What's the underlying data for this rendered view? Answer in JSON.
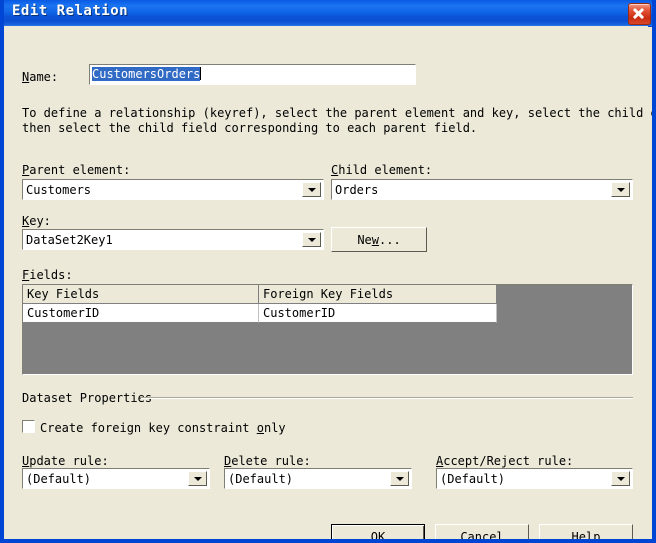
{
  "window": {
    "title": "Edit Relation",
    "close_icon": "close-icon",
    "accent_color": "#0046d5",
    "face_color": "#ece9d8",
    "selection_color": "#316ac5"
  },
  "name_field": {
    "label": "Name:",
    "label_accel": "N",
    "value": "CustomersOrders",
    "selected": true
  },
  "description": {
    "line1": "To define a relationship (keyref), select the parent element and key, select the child element, and",
    "line2": "then select the child field corresponding to each parent field."
  },
  "parent_element": {
    "label": "Parent element:",
    "label_accel": "P",
    "value": "Customers"
  },
  "child_element": {
    "label": "Child element:",
    "label_accel": "C",
    "value": "Orders"
  },
  "key": {
    "label": "Key:",
    "label_accel": "K",
    "value": "DataSet2Key1",
    "new_button": "New..."
  },
  "fields": {
    "label": "Fields:",
    "label_accel": "F",
    "columns": [
      "Key Fields",
      "Foreign Key Fields"
    ],
    "rows": [
      [
        "CustomerID",
        "CustomerID"
      ]
    ]
  },
  "dataset_properties": {
    "group_title": "Dataset Properties",
    "checkbox": {
      "label": "Create foreign key constraint only",
      "checked": false
    },
    "update_rule": {
      "label": "Update rule:",
      "label_accel": "U",
      "value": "(Default)"
    },
    "delete_rule": {
      "label": "Delete rule:",
      "label_accel": "D",
      "value": "(Default)"
    },
    "accept_reject_rule": {
      "label": "Accept/Reject rule:",
      "label_accel": "A",
      "value": "(Default)"
    }
  },
  "buttons": {
    "ok": "OK",
    "cancel": "Cancel",
    "help": "Help"
  }
}
